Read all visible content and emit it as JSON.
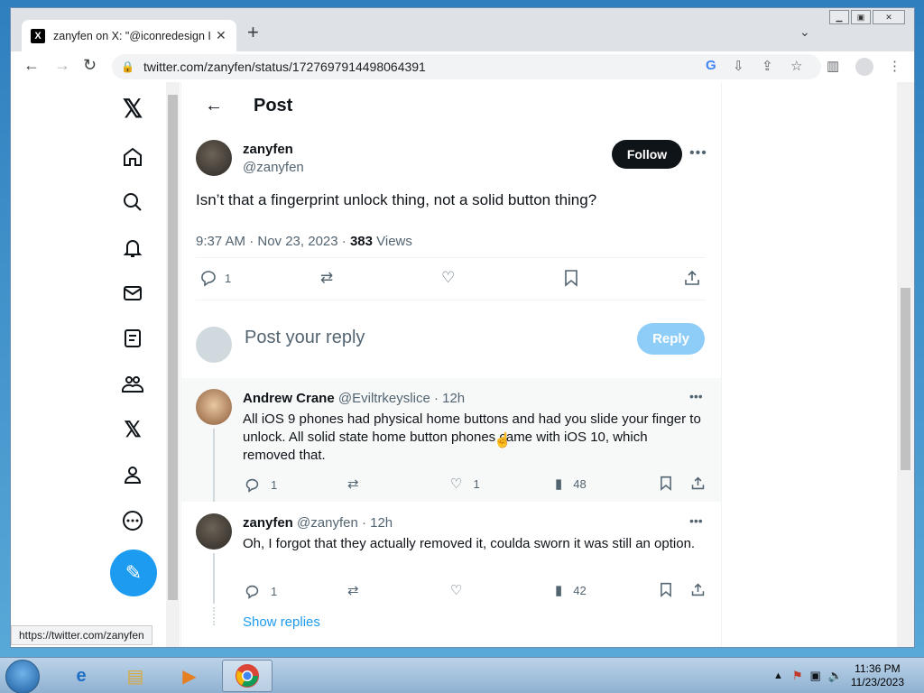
{
  "browser": {
    "tab_title": "zanyfen on X: \"@iconredesign Is",
    "tab_favicon": "X",
    "url": "twitter.com/zanyfen/status/1727697914498064391",
    "status_url": "https://twitter.com/zanyfen"
  },
  "post_header": {
    "title": "Post"
  },
  "post": {
    "name": "zanyfen",
    "handle": "@zanyfen",
    "follow_label": "Follow",
    "text": "Isn’t that a fingerprint unlock thing, not a solid button thing?",
    "time": "9:37 AM · Nov 23, 2023 · ",
    "views_count": "383",
    "views_label": " Views",
    "reply_count": "1"
  },
  "reply_box": {
    "placeholder": "Post your reply",
    "button": "Reply"
  },
  "replies": [
    {
      "name": "Andrew Crane",
      "handle_time": "@Eviltrkeyslice · 12h",
      "text": "All iOS 9 phones had physical home buttons and had you slide your finger to unlock. All solid state home button phones came with iOS 10, which removed that.",
      "replies": "1",
      "likes": "1",
      "views": "48"
    },
    {
      "name": "zanyfen",
      "handle_time": "@zanyfen · 12h",
      "text": "Oh, I forgot that they actually removed it, coulda sworn it was still an option.",
      "replies": "1",
      "views": "42",
      "show_replies": "Show replies"
    }
  ],
  "taskbar": {
    "time": "11:36 PM",
    "date": "11/23/2023"
  },
  "colors": {
    "accent": "#1d9bf0",
    "reply_disabled": "#8ecdf8",
    "text": "#0f1419",
    "muted": "#536471"
  }
}
